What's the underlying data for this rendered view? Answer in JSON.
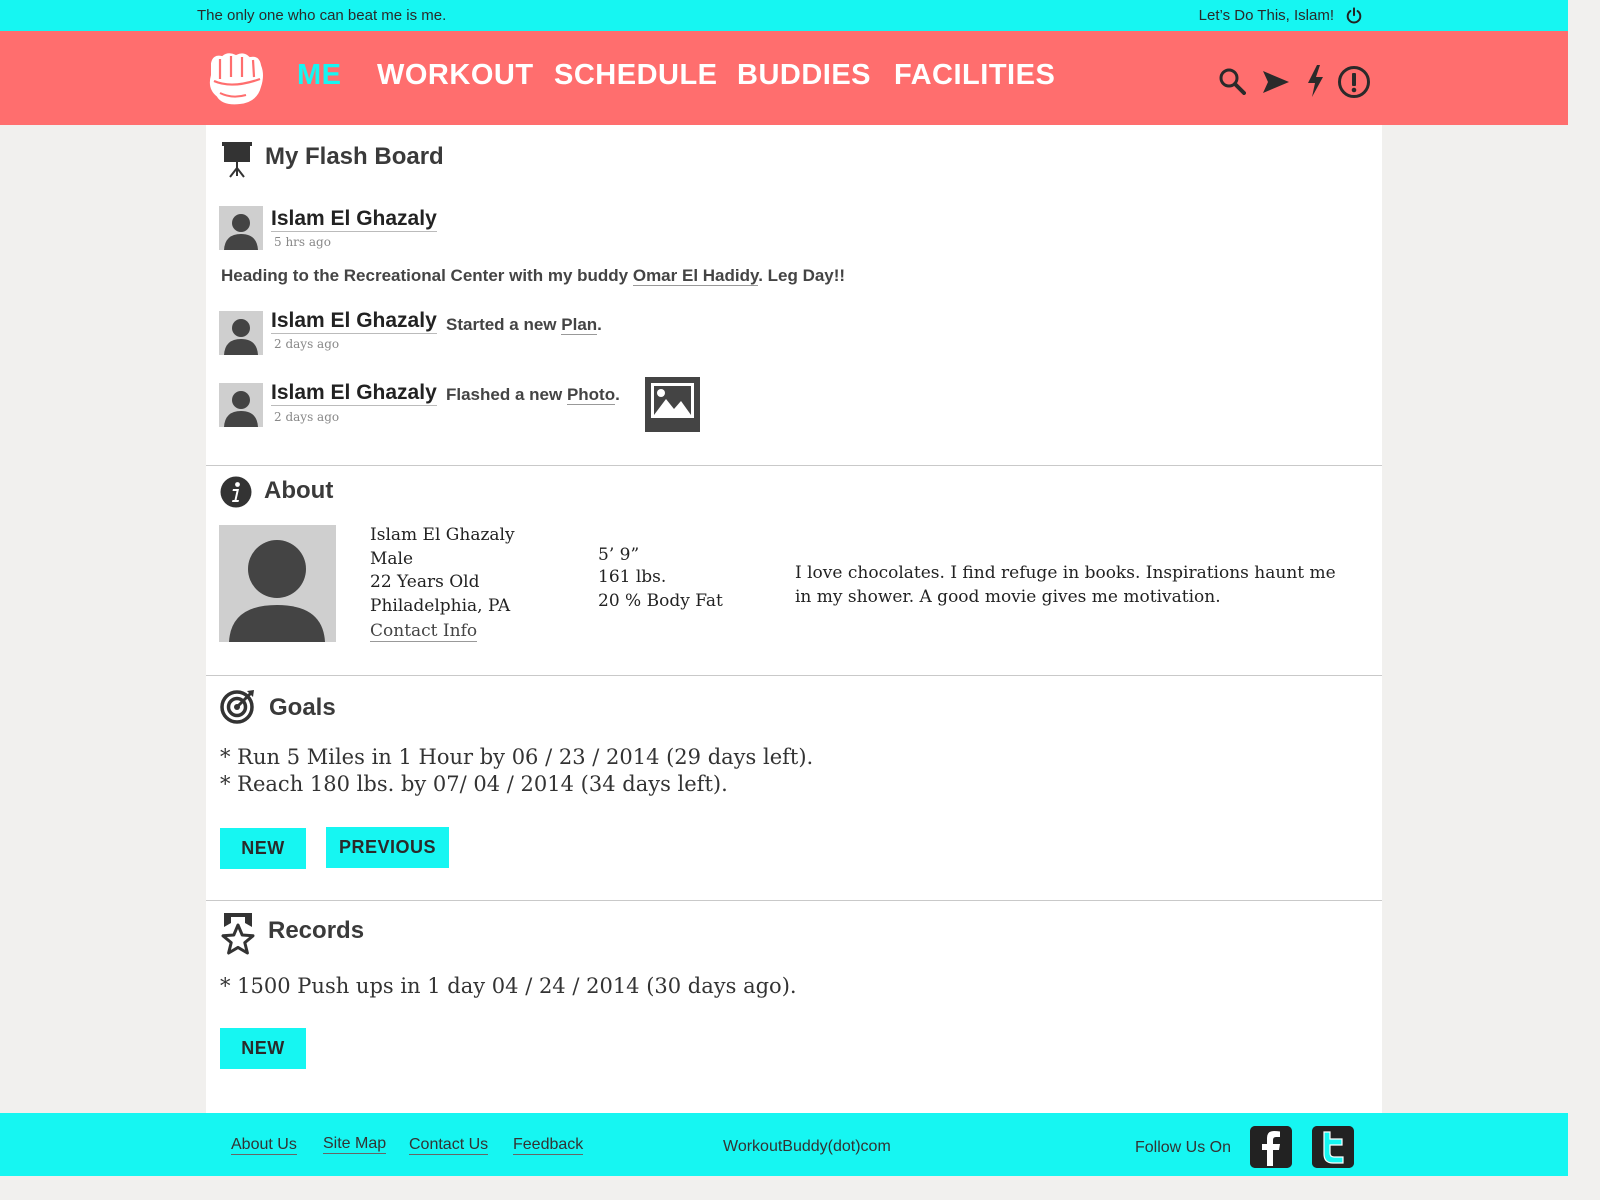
{
  "topbar": {
    "motto": "The only one who can beat me is me.",
    "greeting": "Let’s Do This, Islam!",
    "power_icon": "power-icon"
  },
  "nav": {
    "logo_icon": "fist-logo-icon",
    "items": [
      {
        "label": "ME",
        "active": true
      },
      {
        "label": "WORKOUT",
        "active": false
      },
      {
        "label": "SCHEDULE",
        "active": false
      },
      {
        "label": "BUDDIES",
        "active": false
      },
      {
        "label": "FACILITIES",
        "active": false
      }
    ],
    "icons": [
      "search-icon",
      "send-icon",
      "lightning-icon",
      "alert-icon"
    ]
  },
  "flashboard": {
    "title": "My Flash Board",
    "icon": "presentation-board-icon",
    "posts": [
      {
        "name": "Islam El Ghazaly",
        "time": "5 hrs ago",
        "text_before": "Heading to the Recreational Center with my buddy ",
        "text_link": "Omar El Hadidy",
        "text_after": ". Leg Day!!"
      },
      {
        "name": "Islam El Ghazaly",
        "time": "2  days ago",
        "action_before": "Started a new ",
        "action_link": "Plan",
        "action_after": "."
      },
      {
        "name": "Islam El Ghazaly",
        "time": "2  days ago",
        "action_before": "Flashed a new ",
        "action_link": "Photo",
        "action_after": ".",
        "thumb_icon": "image-icon"
      }
    ]
  },
  "about": {
    "title": "About",
    "icon": "info-icon",
    "name": "Islam El Ghazaly",
    "gender": "Male",
    "age": "22 Years Old",
    "location": "Philadelphia, PA",
    "contact_link": "Contact Info",
    "height": "5’ 9”",
    "weight": "161 lbs.",
    "body_fat": "20 % Body Fat",
    "bio_line1": "I love chocolates. I find refuge in books. Inspirations haunt me",
    "bio_line2": "in my shower. A good movie gives me motivation."
  },
  "goals": {
    "title": "Goals",
    "icon": "target-icon",
    "items": [
      "* Run 5 Miles in 1 Hour by 06 / 23 / 2014 (29 days left).",
      "* Reach 180 lbs. by 07/ 04 / 2014 (34 days left)."
    ],
    "new_label": "NEW",
    "previous_label": "PREVIOUS"
  },
  "records": {
    "title": "Records",
    "icon": "medal-star-icon",
    "items": [
      "* 1500 Push ups in 1 day 04 / 24 / 2014 (30 days ago)."
    ],
    "new_label": "NEW"
  },
  "footer": {
    "links": [
      "About Us",
      "Site Map",
      "Contact Us",
      "Feedback"
    ],
    "site": "WorkoutBuddy(dot)com",
    "follow": "Follow Us On",
    "social_icons": [
      "facebook-icon",
      "twitter-icon"
    ]
  },
  "colors": {
    "accent_cyan": "#16f6f2",
    "nav_coral": "#ff6e6e"
  }
}
